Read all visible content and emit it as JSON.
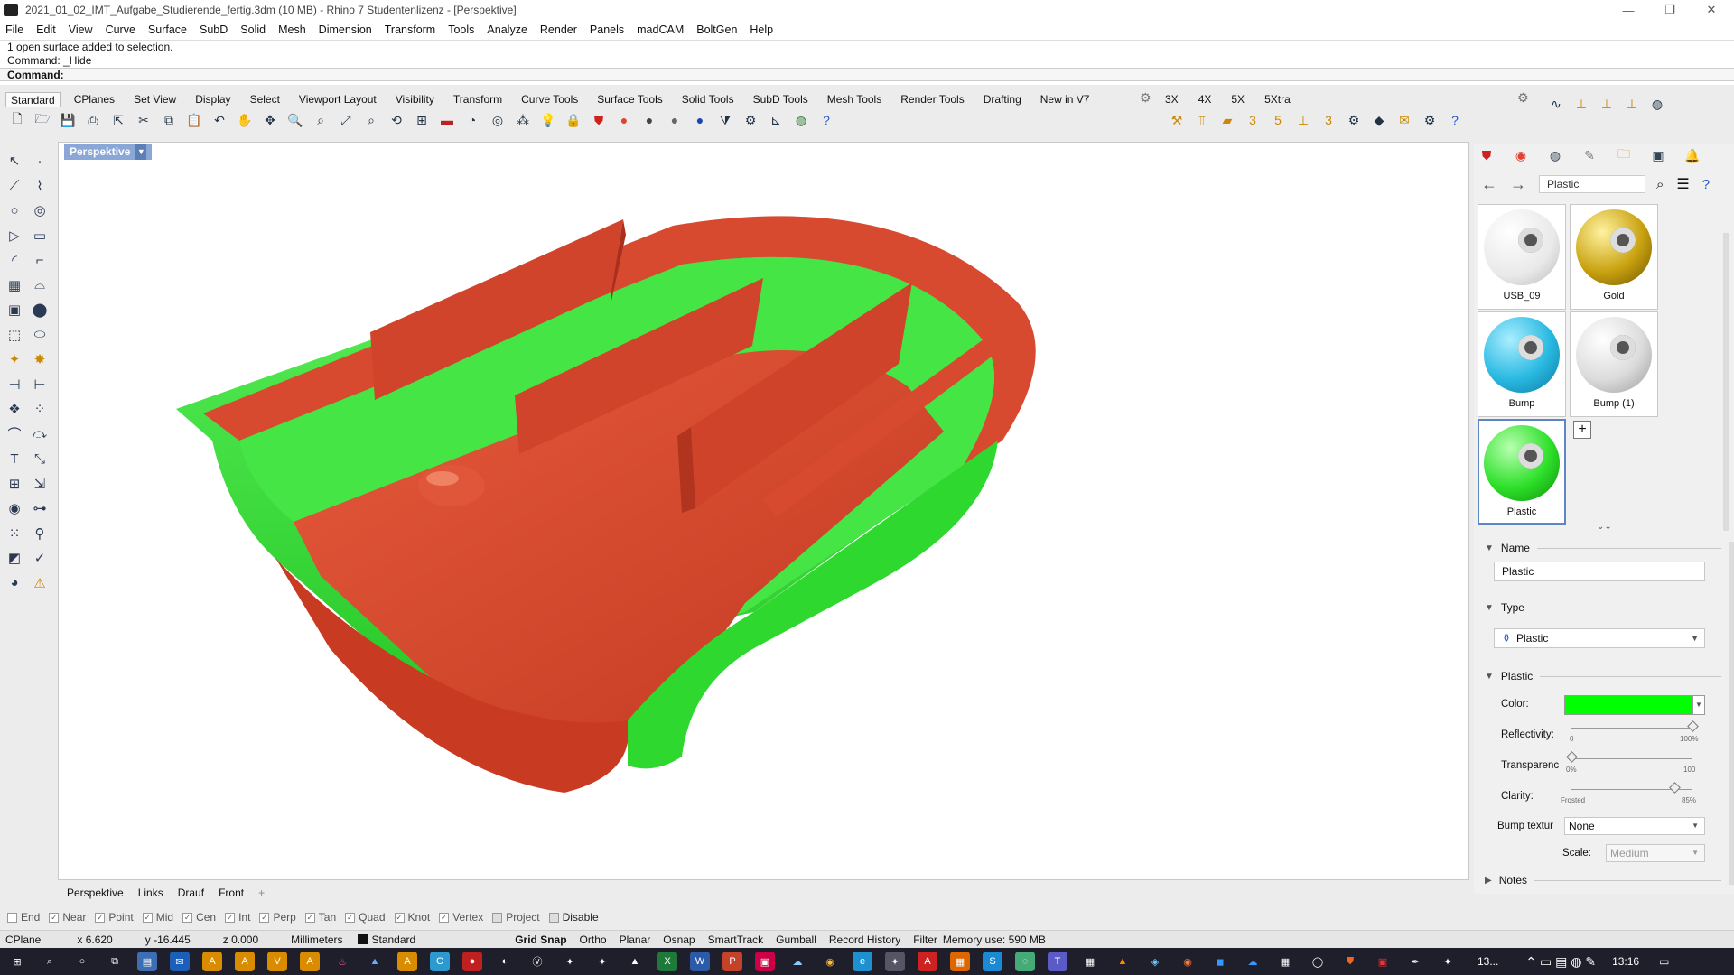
{
  "window": {
    "title": "2021_01_02_IMT_Aufgabe_Studierende_fertig.3dm (10 MB) - Rhino 7 Studentenlizenz - [Perspektive]",
    "minimize": "—",
    "maximize": "❐",
    "close": "✕"
  },
  "menu": [
    "File",
    "Edit",
    "View",
    "Curve",
    "Surface",
    "SubD",
    "Solid",
    "Mesh",
    "Dimension",
    "Transform",
    "Tools",
    "Analyze",
    "Render",
    "Panels",
    "madCAM",
    "BoltGen",
    "Help"
  ],
  "command": {
    "line1": "1 open surface added to selection.",
    "line2": "Command: _Hide",
    "prompt": "Command:"
  },
  "toolbar_tabs": [
    "Standard",
    "CPlanes",
    "Set View",
    "Display",
    "Select",
    "Viewport Layout",
    "Visibility",
    "Transform",
    "Curve Tools",
    "Surface Tools",
    "Solid Tools",
    "SubD Tools",
    "Mesh Tools",
    "Render Tools",
    "Drafting",
    "New in V7"
  ],
  "toolbar_tabs_right": [
    "3X",
    "4X",
    "5X",
    "5Xtra"
  ],
  "viewport": {
    "active_label": "Perspektive",
    "bottom_tabs": [
      "Perspektive",
      "Links",
      "Drauf",
      "Front"
    ],
    "add_tab": "+"
  },
  "osnap": {
    "items": [
      {
        "label": "End",
        "checked": false
      },
      {
        "label": "Near",
        "checked": true
      },
      {
        "label": "Point",
        "checked": true
      },
      {
        "label": "Mid",
        "checked": true
      },
      {
        "label": "Cen",
        "checked": true
      },
      {
        "label": "Int",
        "checked": true
      },
      {
        "label": "Perp",
        "checked": true
      },
      {
        "label": "Tan",
        "checked": true
      },
      {
        "label": "Quad",
        "checked": true
      },
      {
        "label": "Knot",
        "checked": true
      },
      {
        "label": "Vertex",
        "checked": true
      },
      {
        "label": "Project",
        "checked": false
      },
      {
        "label": "Disable",
        "checked": false
      }
    ]
  },
  "status": {
    "cplane": "CPlane",
    "x": "x 6.620",
    "y": "y -16.445",
    "z": "z 0.000",
    "units": "Millimeters",
    "layer": "Standard",
    "grid_snap": "Grid Snap",
    "ortho": "Ortho",
    "planar": "Planar",
    "osnap": "Osnap",
    "smarttrack": "SmartTrack",
    "gumball": "Gumball",
    "record_history": "Record History",
    "filter": "Filter",
    "memory": "Memory use: 590 MB"
  },
  "materials_panel": {
    "breadcrumb": "Plastic",
    "materials": [
      {
        "name": "USB_09",
        "color": "#e9e9e9"
      },
      {
        "name": "Gold",
        "color": "#c9a210"
      },
      {
        "name": "Bump",
        "color": "#29b9e2"
      },
      {
        "name": "Bump (1)",
        "color": "#dcdcdc"
      },
      {
        "name": "Plastic",
        "color": "#2ee02a"
      }
    ],
    "add_button": "+",
    "more": "⌄⌄",
    "name_section": "Name",
    "name_value": "Plastic",
    "type_section": "Type",
    "type_value": "Plastic",
    "plastic_section": "Plastic",
    "color_label": "Color:",
    "color_value": "#00ff00",
    "reflectivity_label": "Reflectivity:",
    "reflectivity_min": "0",
    "reflectivity_max": "100%",
    "reflectivity": 1.0,
    "transparency_label": "Transparenc",
    "transparency_min": "0%",
    "transparency_max": "100",
    "transparency": 0.0,
    "clarity_label": "Clarity:",
    "clarity_min": "Frosted",
    "clarity_max": "85%",
    "clarity": 0.85,
    "bump_label": "Bump textur",
    "bump_value": "None",
    "scale_label": "Scale:",
    "scale_value": "Medium",
    "notes_section": "Notes"
  },
  "taskbar": {
    "clock": "13:16",
    "tray_text": "13..."
  },
  "colors": {
    "model_red": "#d84a30",
    "model_green": "#33dd33",
    "viewport_label": "#8aa7d8",
    "selected_border": "#5f86c4"
  }
}
